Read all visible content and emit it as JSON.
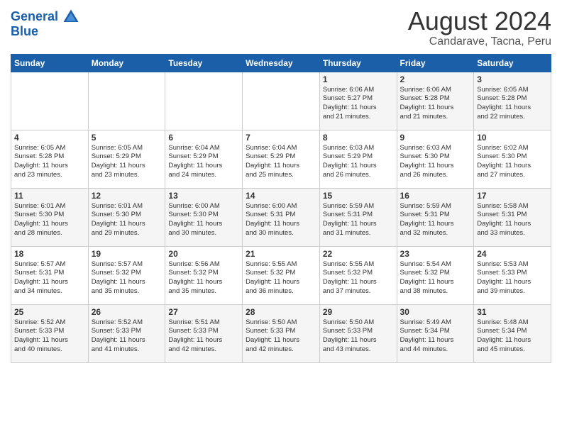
{
  "header": {
    "logo_line1": "General",
    "logo_line2": "Blue",
    "title": "August 2024",
    "subtitle": "Candarave, Tacna, Peru"
  },
  "weekdays": [
    "Sunday",
    "Monday",
    "Tuesday",
    "Wednesday",
    "Thursday",
    "Friday",
    "Saturday"
  ],
  "weeks": [
    [
      {
        "day": "",
        "info": ""
      },
      {
        "day": "",
        "info": ""
      },
      {
        "day": "",
        "info": ""
      },
      {
        "day": "",
        "info": ""
      },
      {
        "day": "1",
        "info": "Sunrise: 6:06 AM\nSunset: 5:27 PM\nDaylight: 11 hours\nand 21 minutes."
      },
      {
        "day": "2",
        "info": "Sunrise: 6:06 AM\nSunset: 5:28 PM\nDaylight: 11 hours\nand 21 minutes."
      },
      {
        "day": "3",
        "info": "Sunrise: 6:05 AM\nSunset: 5:28 PM\nDaylight: 11 hours\nand 22 minutes."
      }
    ],
    [
      {
        "day": "4",
        "info": "Sunrise: 6:05 AM\nSunset: 5:28 PM\nDaylight: 11 hours\nand 23 minutes."
      },
      {
        "day": "5",
        "info": "Sunrise: 6:05 AM\nSunset: 5:29 PM\nDaylight: 11 hours\nand 23 minutes."
      },
      {
        "day": "6",
        "info": "Sunrise: 6:04 AM\nSunset: 5:29 PM\nDaylight: 11 hours\nand 24 minutes."
      },
      {
        "day": "7",
        "info": "Sunrise: 6:04 AM\nSunset: 5:29 PM\nDaylight: 11 hours\nand 25 minutes."
      },
      {
        "day": "8",
        "info": "Sunrise: 6:03 AM\nSunset: 5:29 PM\nDaylight: 11 hours\nand 26 minutes."
      },
      {
        "day": "9",
        "info": "Sunrise: 6:03 AM\nSunset: 5:30 PM\nDaylight: 11 hours\nand 26 minutes."
      },
      {
        "day": "10",
        "info": "Sunrise: 6:02 AM\nSunset: 5:30 PM\nDaylight: 11 hours\nand 27 minutes."
      }
    ],
    [
      {
        "day": "11",
        "info": "Sunrise: 6:01 AM\nSunset: 5:30 PM\nDaylight: 11 hours\nand 28 minutes."
      },
      {
        "day": "12",
        "info": "Sunrise: 6:01 AM\nSunset: 5:30 PM\nDaylight: 11 hours\nand 29 minutes."
      },
      {
        "day": "13",
        "info": "Sunrise: 6:00 AM\nSunset: 5:30 PM\nDaylight: 11 hours\nand 30 minutes."
      },
      {
        "day": "14",
        "info": "Sunrise: 6:00 AM\nSunset: 5:31 PM\nDaylight: 11 hours\nand 30 minutes."
      },
      {
        "day": "15",
        "info": "Sunrise: 5:59 AM\nSunset: 5:31 PM\nDaylight: 11 hours\nand 31 minutes."
      },
      {
        "day": "16",
        "info": "Sunrise: 5:59 AM\nSunset: 5:31 PM\nDaylight: 11 hours\nand 32 minutes."
      },
      {
        "day": "17",
        "info": "Sunrise: 5:58 AM\nSunset: 5:31 PM\nDaylight: 11 hours\nand 33 minutes."
      }
    ],
    [
      {
        "day": "18",
        "info": "Sunrise: 5:57 AM\nSunset: 5:31 PM\nDaylight: 11 hours\nand 34 minutes."
      },
      {
        "day": "19",
        "info": "Sunrise: 5:57 AM\nSunset: 5:32 PM\nDaylight: 11 hours\nand 35 minutes."
      },
      {
        "day": "20",
        "info": "Sunrise: 5:56 AM\nSunset: 5:32 PM\nDaylight: 11 hours\nand 35 minutes."
      },
      {
        "day": "21",
        "info": "Sunrise: 5:55 AM\nSunset: 5:32 PM\nDaylight: 11 hours\nand 36 minutes."
      },
      {
        "day": "22",
        "info": "Sunrise: 5:55 AM\nSunset: 5:32 PM\nDaylight: 11 hours\nand 37 minutes."
      },
      {
        "day": "23",
        "info": "Sunrise: 5:54 AM\nSunset: 5:32 PM\nDaylight: 11 hours\nand 38 minutes."
      },
      {
        "day": "24",
        "info": "Sunrise: 5:53 AM\nSunset: 5:33 PM\nDaylight: 11 hours\nand 39 minutes."
      }
    ],
    [
      {
        "day": "25",
        "info": "Sunrise: 5:52 AM\nSunset: 5:33 PM\nDaylight: 11 hours\nand 40 minutes."
      },
      {
        "day": "26",
        "info": "Sunrise: 5:52 AM\nSunset: 5:33 PM\nDaylight: 11 hours\nand 41 minutes."
      },
      {
        "day": "27",
        "info": "Sunrise: 5:51 AM\nSunset: 5:33 PM\nDaylight: 11 hours\nand 42 minutes."
      },
      {
        "day": "28",
        "info": "Sunrise: 5:50 AM\nSunset: 5:33 PM\nDaylight: 11 hours\nand 42 minutes."
      },
      {
        "day": "29",
        "info": "Sunrise: 5:50 AM\nSunset: 5:33 PM\nDaylight: 11 hours\nand 43 minutes."
      },
      {
        "day": "30",
        "info": "Sunrise: 5:49 AM\nSunset: 5:34 PM\nDaylight: 11 hours\nand 44 minutes."
      },
      {
        "day": "31",
        "info": "Sunrise: 5:48 AM\nSunset: 5:34 PM\nDaylight: 11 hours\nand 45 minutes."
      }
    ]
  ]
}
